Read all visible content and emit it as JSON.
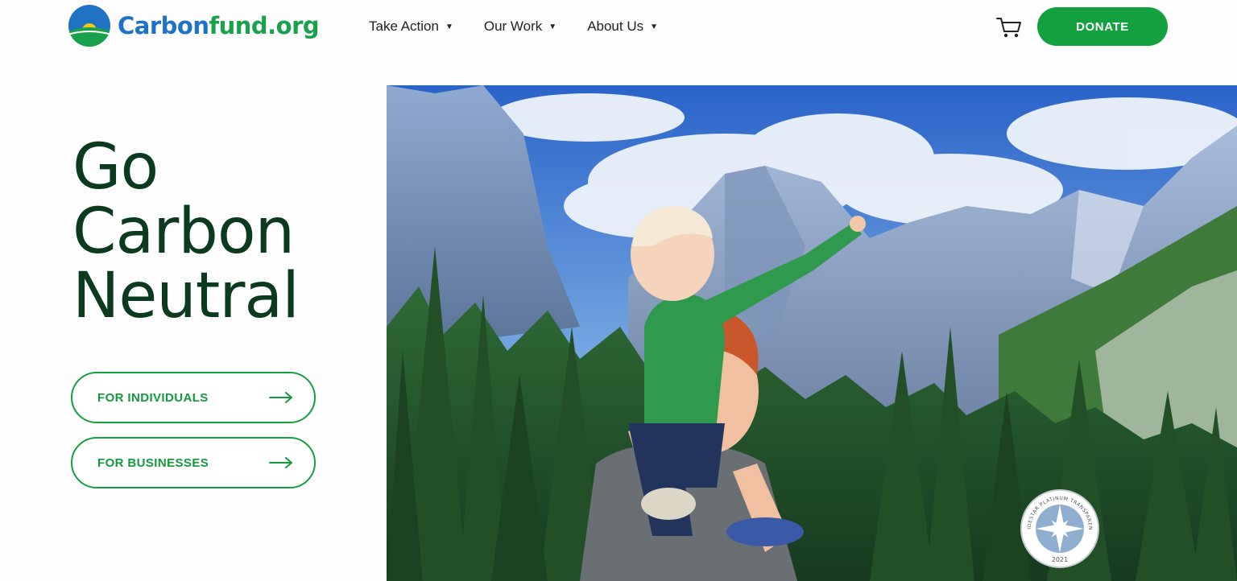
{
  "brand": {
    "name_part1": "Carbon",
    "name_part2": "fund.org",
    "logo_icon": "sun-over-hill-logo",
    "colors": {
      "blue": "#1f73c4",
      "green": "#1aa14b",
      "yellow": "#f5c518"
    }
  },
  "nav": {
    "items": [
      {
        "label": "Take Action",
        "icon": "caret-down-icon"
      },
      {
        "label": "Our Work",
        "icon": "caret-down-icon"
      },
      {
        "label": "About Us",
        "icon": "caret-down-icon"
      }
    ],
    "cart_icon": "shopping-cart-icon",
    "donate_label": "DONATE",
    "accent_color": "#13a13f"
  },
  "hero": {
    "title_lines": [
      "Go",
      "Carbon",
      "Neutral"
    ],
    "cta": [
      {
        "label": "FOR INDIVIDUALS",
        "icon": "arrow-right-icon"
      },
      {
        "label": "FOR BUSINESSES",
        "icon": "arrow-right-icon"
      }
    ],
    "image_subject": "child on mother's shoulders pointing at mountains",
    "badge": {
      "text": "GUIDESTAR PLATINUM TRANSPARENCY",
      "year": "2021"
    }
  }
}
